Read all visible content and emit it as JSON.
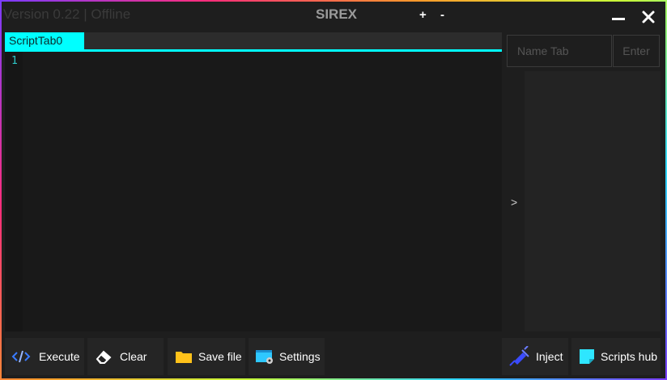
{
  "titlebar": {
    "version_text": "Version 0.22 | Offline",
    "app_title": "SIREX",
    "zoom_in_label": "+",
    "zoom_out_label": "-"
  },
  "tabs": [
    {
      "label": "ScriptTab0"
    }
  ],
  "editor": {
    "line_numbers": [
      "1"
    ]
  },
  "side_panel": {
    "name_tab_placeholder": "Name Tab",
    "enter_label": "Enter",
    "expand_label": ">"
  },
  "toolbar": {
    "execute_label": "Execute",
    "clear_label": "Clear",
    "save_file_label": "Save file",
    "settings_label": "Settings",
    "inject_label": "Inject",
    "scripts_hub_label": "Scripts hub"
  },
  "icons": {
    "execute": "code-brackets-icon",
    "clear": "eraser-icon",
    "save": "folder-icon",
    "settings": "window-gear-icon",
    "inject": "syringe-icon",
    "scripts_hub": "sticky-note-icon",
    "minimize": "minimize-icon",
    "close": "close-icon"
  },
  "colors": {
    "accent": "#00ffff",
    "background": "#1e1e1e",
    "editor_background": "#191919",
    "execute_icon": "#3a7bff",
    "folder_icon": "#ffc21a",
    "inject_icon": "#3a4bff",
    "scripts_hub_icon": "#2ee6ff"
  }
}
